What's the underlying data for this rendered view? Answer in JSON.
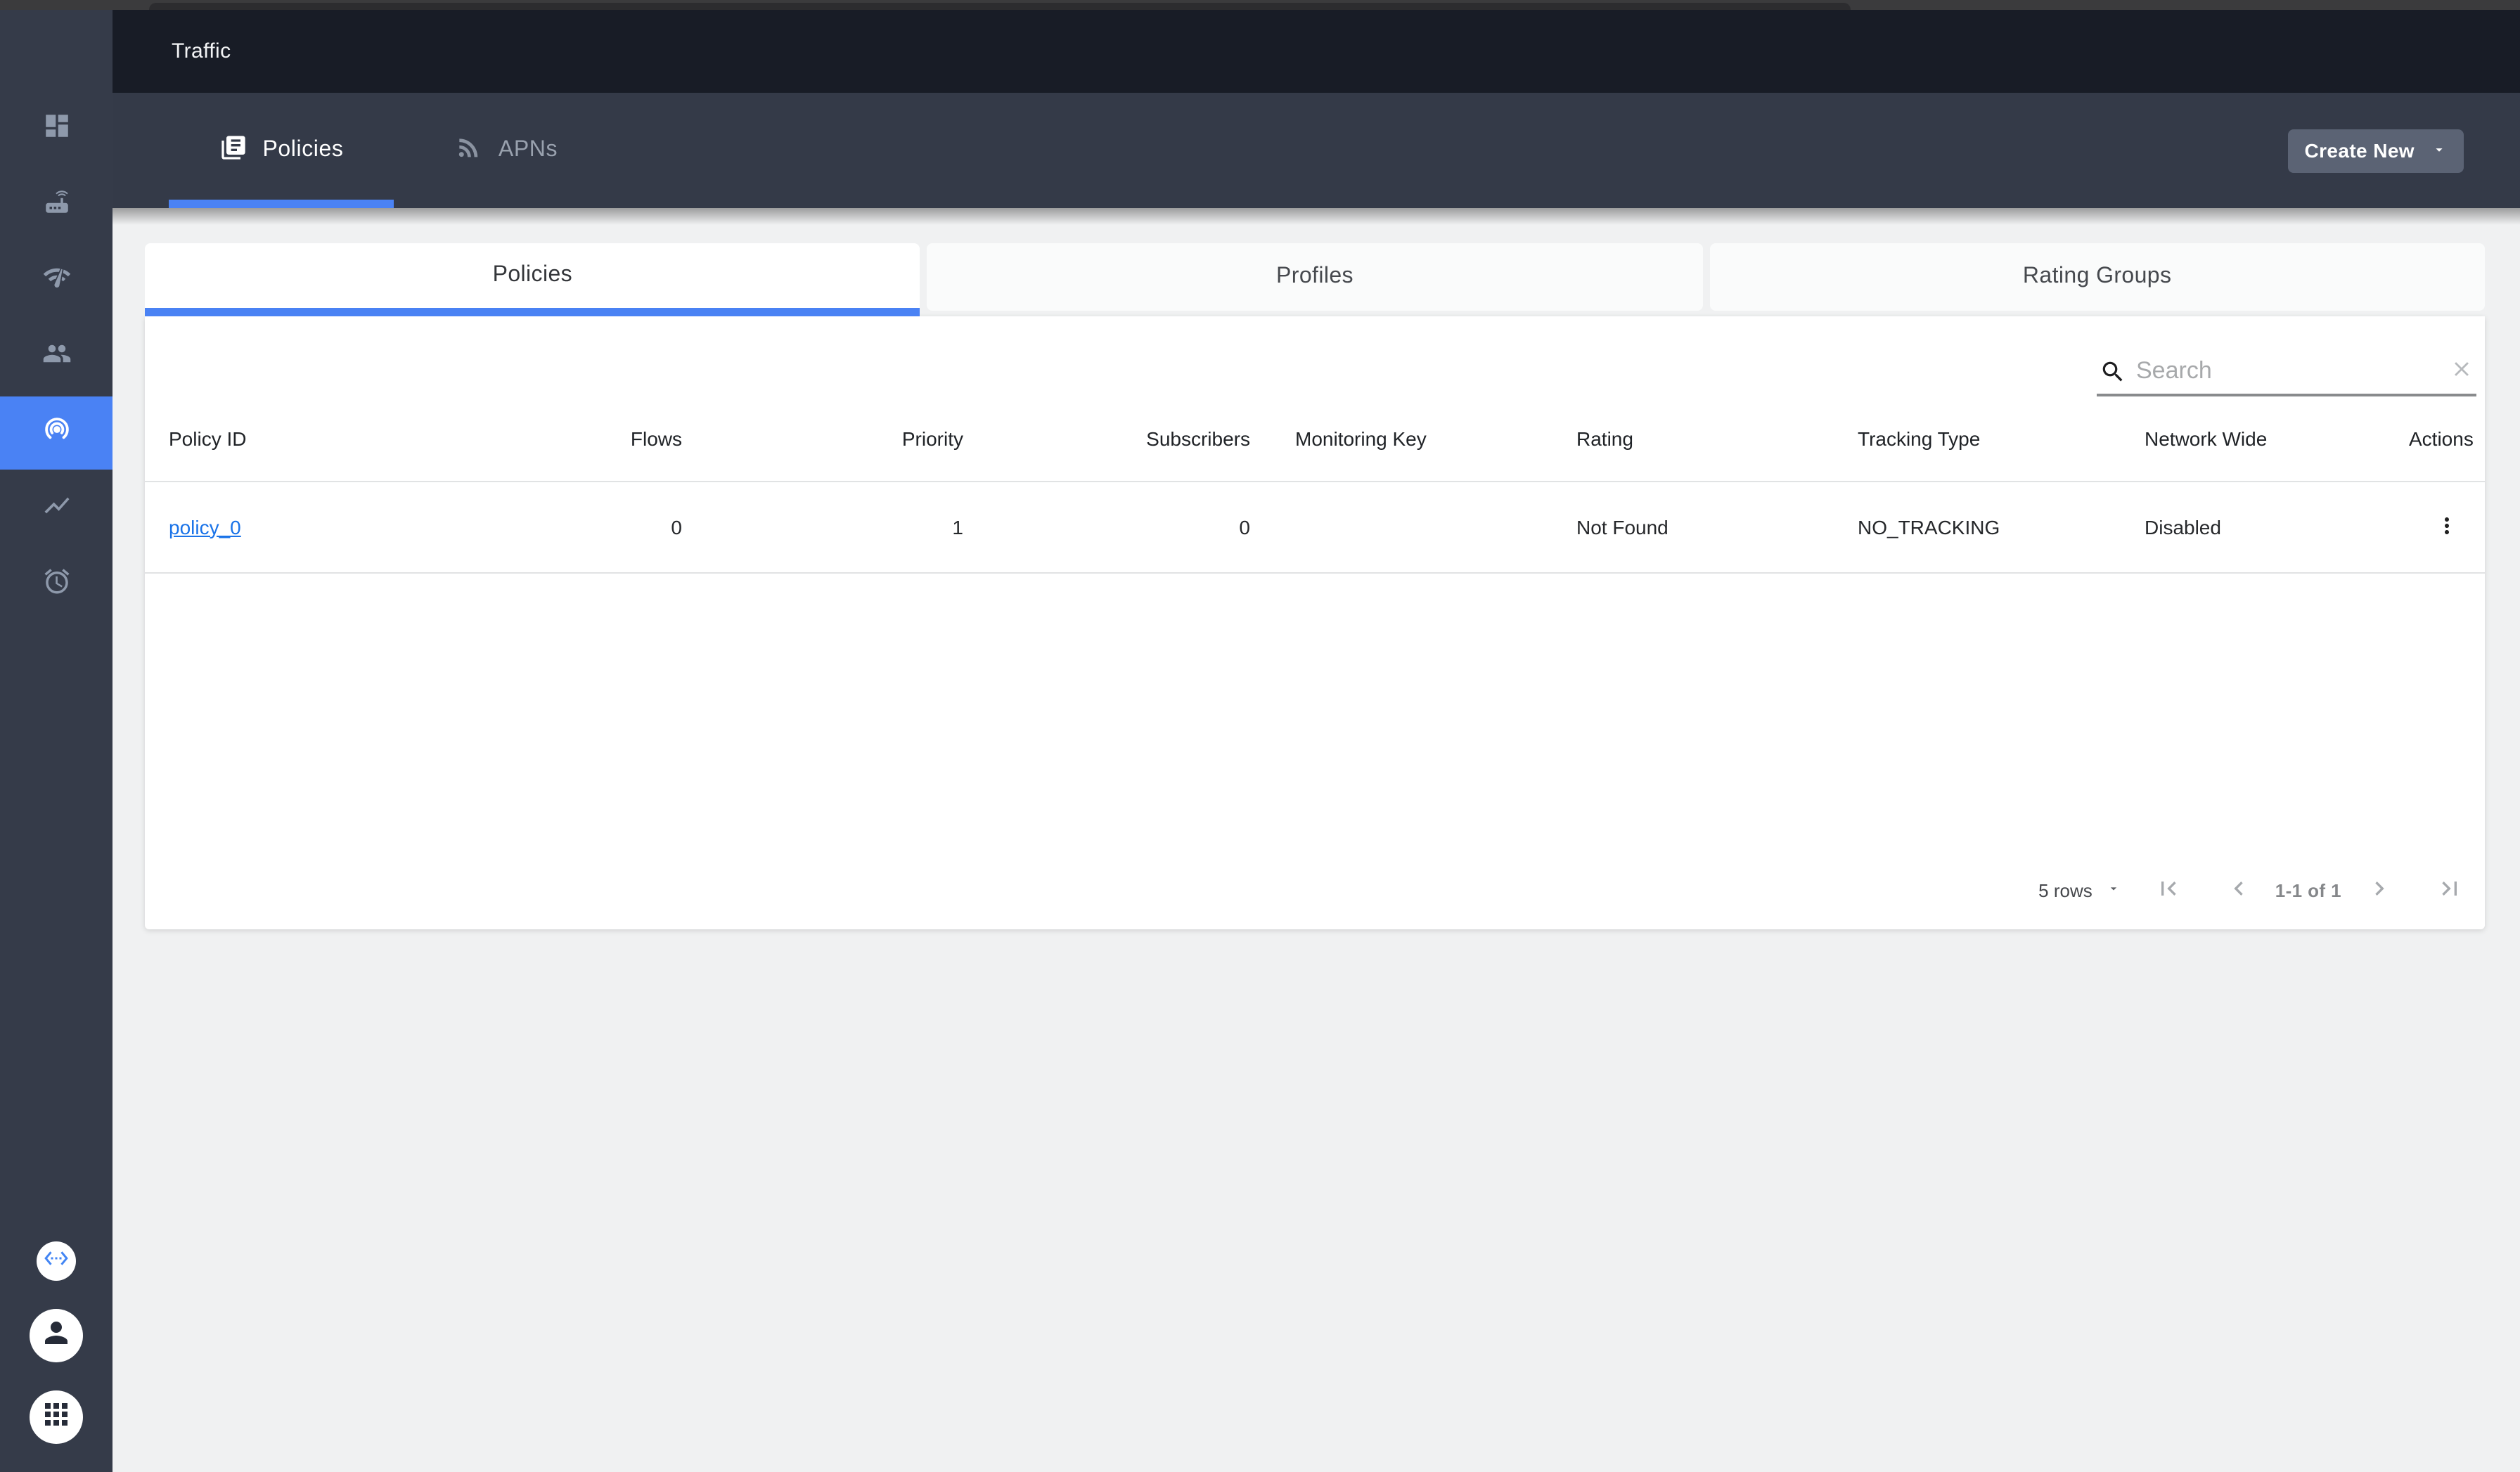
{
  "colors": {
    "accent_blue": "#4a82f4",
    "link_blue": "#1a73e8",
    "appbar_bg": "#181c26",
    "tabbar_bg": "#343a48",
    "sidebar_bg": "#353b49",
    "content_bg": "#f0f1f2",
    "create_button_bg": "#5b6374"
  },
  "header": {
    "title": "Traffic"
  },
  "tabbar": {
    "tabs": [
      {
        "label": "Policies",
        "icon": "library-books-icon",
        "active": true
      },
      {
        "label": "APNs",
        "icon": "rss-feed-icon",
        "active": false
      }
    ],
    "create_button": {
      "label": "Create New"
    }
  },
  "sidebar": {
    "items": [
      {
        "icon": "dashboard-icon",
        "active": false
      },
      {
        "icon": "equipment-router-icon",
        "active": false
      },
      {
        "icon": "network-check-icon",
        "active": false
      },
      {
        "icon": "subscribers-people-icon",
        "active": false
      },
      {
        "icon": "traffic-track-changes-icon",
        "active": true
      },
      {
        "icon": "metrics-chart-icon",
        "active": false
      },
      {
        "icon": "alarms-alarm-clock-icon",
        "active": false
      }
    ],
    "footer": [
      {
        "icon": "api-code-icon"
      },
      {
        "icon": "account-person-icon"
      },
      {
        "icon": "apps-grid-icon"
      }
    ]
  },
  "card": {
    "subtabs": [
      {
        "label": "Policies",
        "active": true
      },
      {
        "label": "Profiles",
        "active": false
      },
      {
        "label": "Rating Groups",
        "active": false
      }
    ],
    "search": {
      "placeholder": "Search",
      "value": ""
    },
    "table": {
      "columns": [
        {
          "label": "Policy ID",
          "align": "left"
        },
        {
          "label": "Flows",
          "align": "right"
        },
        {
          "label": "Priority",
          "align": "right"
        },
        {
          "label": "Subscribers",
          "align": "right"
        },
        {
          "label": "Monitoring Key",
          "align": "left"
        },
        {
          "label": "Rating",
          "align": "left"
        },
        {
          "label": "Tracking Type",
          "align": "left"
        },
        {
          "label": "Network Wide",
          "align": "left"
        },
        {
          "label": "Actions",
          "align": "right"
        }
      ],
      "rows": [
        {
          "policy_id": "policy_0",
          "flows": "0",
          "priority": "1",
          "subscribers": "0",
          "monitoring_key": "",
          "rating": "Not Found",
          "tracking_type": "NO_TRACKING",
          "network_wide": "Disabled"
        }
      ]
    },
    "pagination": {
      "rows_per_page": "5 rows",
      "range": "1-1 of 1"
    }
  }
}
